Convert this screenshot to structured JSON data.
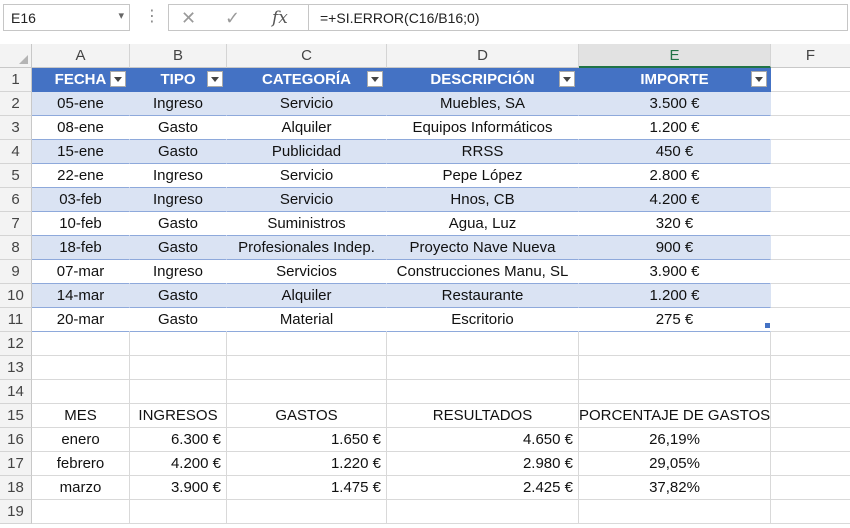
{
  "name_box": "E16",
  "formula": "=+SI.ERROR(C16/B16;0)",
  "columns": [
    "A",
    "B",
    "C",
    "D",
    "E",
    "F"
  ],
  "rows": [
    "1",
    "2",
    "3",
    "4",
    "5",
    "6",
    "7",
    "8",
    "9",
    "10",
    "11",
    "12",
    "13",
    "14",
    "15",
    "16",
    "17",
    "18",
    "19"
  ],
  "table": {
    "headers": [
      "FECHA",
      "TIPO",
      "CATEGORÍA",
      "DESCRIPCIÓN",
      "IMPORTE"
    ],
    "rows": [
      [
        "05-ene",
        "Ingreso",
        "Servicio",
        "Muebles, SA",
        "3.500 €"
      ],
      [
        "08-ene",
        "Gasto",
        "Alquiler",
        "Equipos Informáticos",
        "1.200 €"
      ],
      [
        "15-ene",
        "Gasto",
        "Publicidad",
        "RRSS",
        "450 €"
      ],
      [
        "22-ene",
        "Ingreso",
        "Servicio",
        "Pepe López",
        "2.800 €"
      ],
      [
        "03-feb",
        "Ingreso",
        "Servicio",
        "Hnos, CB",
        "4.200 €"
      ],
      [
        "10-feb",
        "Gasto",
        "Suministros",
        "Agua, Luz",
        "320 €"
      ],
      [
        "18-feb",
        "Gasto",
        "Profesionales Indep.",
        "Proyecto Nave Nueva",
        "900 €"
      ],
      [
        "07-mar",
        "Ingreso",
        "Servicios",
        "Construcciones Manu, SL",
        "3.900 €"
      ],
      [
        "14-mar",
        "Gasto",
        "Alquiler",
        "Restaurante",
        "1.200 €"
      ],
      [
        "20-mar",
        "Gasto",
        "Material",
        "Escritorio",
        "275 €"
      ]
    ]
  },
  "summary": {
    "headers": [
      "MES",
      "INGRESOS",
      "GASTOS",
      "RESULTADOS",
      "PORCENTAJE DE GASTOS"
    ],
    "rows": [
      [
        "enero",
        "6.300 €",
        "1.650 €",
        "4.650 €",
        "26,19%"
      ],
      [
        "febrero",
        "4.200 €",
        "1.220 €",
        "2.980 €",
        "29,05%"
      ],
      [
        "marzo",
        "3.900 €",
        "1.475 €",
        "2.425 €",
        "37,82%"
      ]
    ]
  },
  "colors": {
    "table_header": "#4472c4",
    "band": "#dae3f3",
    "selected_header": "#217346"
  }
}
